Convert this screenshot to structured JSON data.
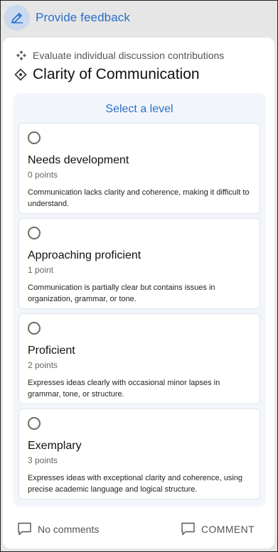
{
  "header": {
    "icon": "pencil-icon",
    "title": "Provide feedback"
  },
  "criterion": {
    "breadcrumb_icon": "diamond-cluster-icon",
    "breadcrumb": "Evaluate individual discussion contributions",
    "title_icon": "diamond-dot-icon",
    "title": "Clarity of Communication"
  },
  "levels_panel": {
    "heading": "Select a level",
    "levels": [
      {
        "name": "Needs development",
        "points": "0 points",
        "description": "Communication lacks clarity and coherence, making it difficult to understand.",
        "selected": false
      },
      {
        "name": "Approaching proficient",
        "points": "1 point",
        "description": "Communication is partially clear but contains issues in organization, grammar, or tone.",
        "selected": false
      },
      {
        "name": "Proficient",
        "points": "2 points",
        "description": "Expresses ideas clearly with occasional minor lapses in grammar, tone, or structure.",
        "selected": false
      },
      {
        "name": "Exemplary",
        "points": "3 points",
        "description": "Expresses ideas with exceptional clarity and coherence, using precise academic language and logical structure.",
        "selected": false
      }
    ]
  },
  "footer": {
    "comments_icon": "comment-icon",
    "comments_status": "No comments",
    "comment_button_icon": "comment-icon",
    "comment_button": "COMMENT"
  },
  "colors": {
    "accent": "#2a6fc9",
    "panel_bg": "#f2f6fb",
    "header_bg": "#e6e6e6"
  }
}
